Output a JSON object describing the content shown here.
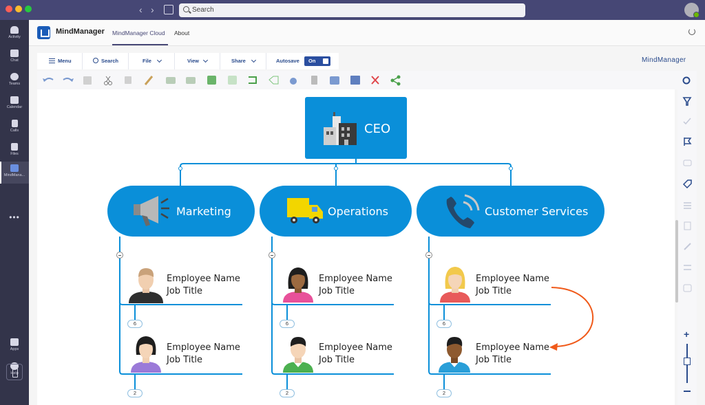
{
  "titlebar": {
    "search_placeholder": "Search"
  },
  "rail": {
    "items": [
      {
        "label": "Activity",
        "icon": "bell-icon"
      },
      {
        "label": "Chat",
        "icon": "chat-icon"
      },
      {
        "label": "Teams",
        "icon": "teams-icon"
      },
      {
        "label": "Calendar",
        "icon": "calendar-icon"
      },
      {
        "label": "Calls",
        "icon": "phone-icon"
      },
      {
        "label": "Files",
        "icon": "file-icon"
      },
      {
        "label": "MindMana...",
        "icon": "mindmanager-icon"
      }
    ],
    "more": "•••",
    "bottom": [
      {
        "label": "Apps",
        "icon": "apps-icon"
      },
      {
        "label": "Help",
        "icon": "help-icon"
      }
    ]
  },
  "app": {
    "name": "MindManager",
    "tabs": [
      {
        "label": "MindManager Cloud",
        "active": true
      },
      {
        "label": "About",
        "active": false
      }
    ]
  },
  "toolbar": {
    "menu": "Menu",
    "search": "Search",
    "file": "File",
    "view": "View",
    "share": "Share",
    "autosave": "Autosave",
    "autosave_state": "On",
    "brand": "MindManager"
  },
  "map": {
    "root": {
      "label": "CEO",
      "icon": "office-building-icon"
    },
    "departments": [
      {
        "label": "Marketing",
        "icon": "megaphone-icon",
        "employees": [
          {
            "name": "Employee Name",
            "title": "Job Title",
            "count": "6"
          },
          {
            "name": "Employee Name",
            "title": "Job Title",
            "count": "2"
          }
        ]
      },
      {
        "label": "Operations",
        "icon": "delivery-truck-icon",
        "employees": [
          {
            "name": "Employee Name",
            "title": "Job Title",
            "count": "6"
          },
          {
            "name": "Employee Name",
            "title": "Job Title",
            "count": "2"
          }
        ]
      },
      {
        "label": "Customer Services",
        "icon": "phone-call-icon",
        "employees": [
          {
            "name": "Employee Name",
            "title": "Job Title",
            "count": "6"
          },
          {
            "name": "Employee Name",
            "title": "Job Title",
            "count": "2"
          }
        ]
      }
    ]
  },
  "colors": {
    "topic": "#0a8fd9",
    "connector": "#0a8fd9",
    "relationship_arrow": "#f05a1a",
    "rail": "#33344a",
    "titlebar": "#464775"
  }
}
